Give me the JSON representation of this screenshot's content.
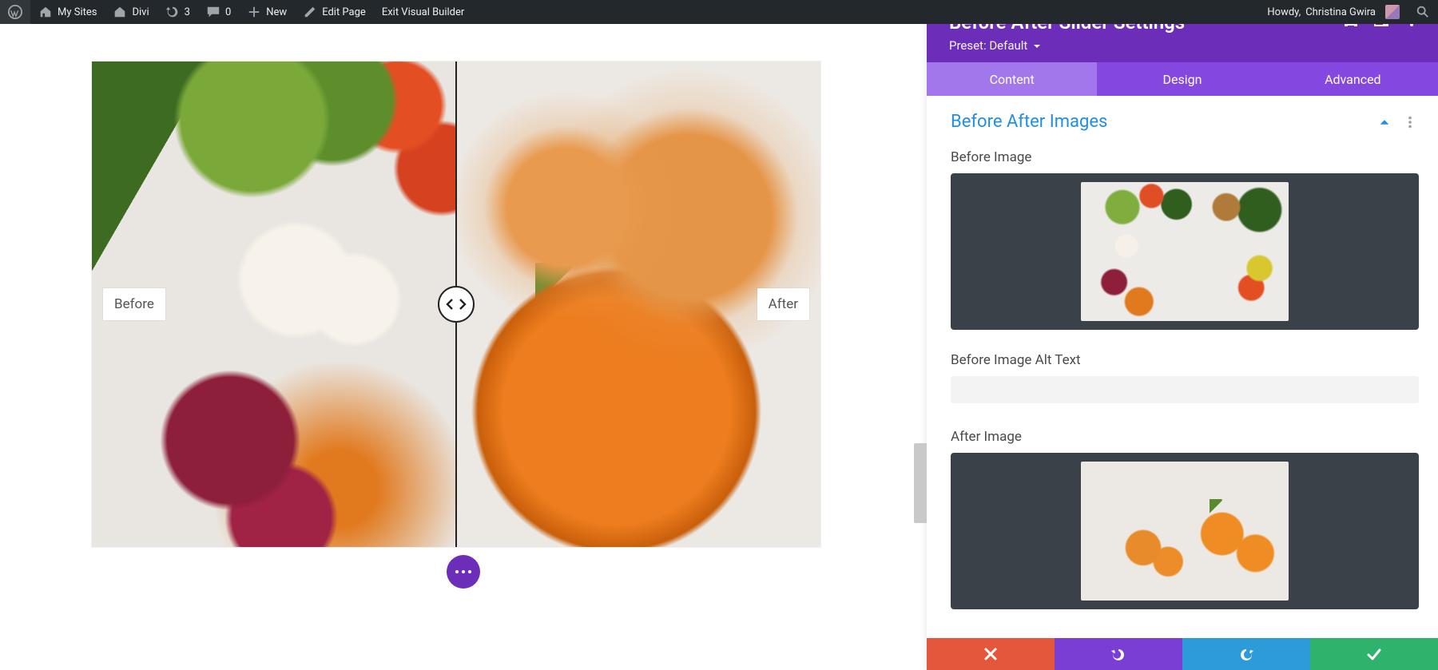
{
  "adminbar": {
    "my_sites": "My Sites",
    "site_name": "Divi",
    "updates_count": "3",
    "comments_count": "0",
    "new_label": "New",
    "edit_page": "Edit Page",
    "exit_vb": "Exit Visual Builder",
    "howdy_prefix": "Howdy, ",
    "user_name": "Christina Gwira"
  },
  "slider": {
    "before_label": "Before",
    "after_label": "After"
  },
  "panel": {
    "title": "Before After Slider Settings",
    "preset_label": "Preset: Default",
    "tabs": {
      "content": "Content",
      "design": "Design",
      "advanced": "Advanced"
    },
    "section_title": "Before After Images",
    "before_image_label": "Before Image",
    "before_alt_label": "Before Image Alt Text",
    "before_alt_value": "",
    "after_image_label": "After Image"
  }
}
